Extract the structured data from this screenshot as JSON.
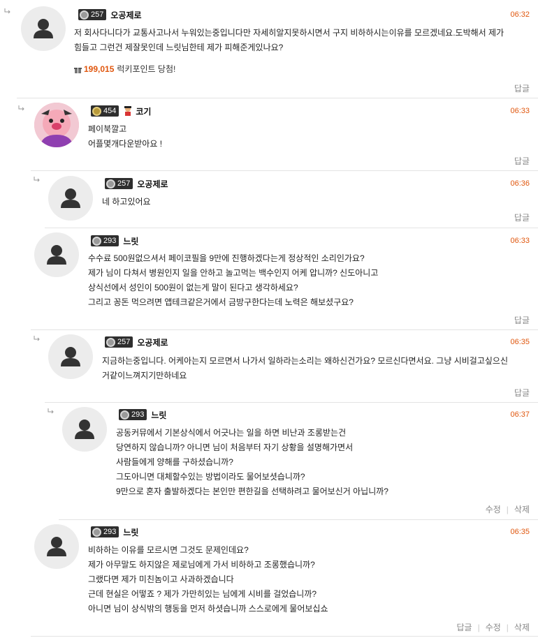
{
  "comments": [
    {
      "level": "257",
      "nickname": "오공제로",
      "time": "06:32",
      "lines": [
        "저 회사다니다가 교통사고나서 누워있는중입니다만 자세히알지못하시면서 구지 비하하시는이유를 모르겠네요.도박해서 제가",
        "힘들고 그런건 제잘못인데 느릿님한테 제가 피해준게있나요?"
      ],
      "lucky_points": "199,015",
      "lucky_label": "럭키포인트 당첨!",
      "reply_label": "답글"
    },
    {
      "level": "454",
      "nickname": "코기",
      "time": "06:33",
      "lines": [
        "페이북깔고",
        "어플몇개다운받아요 !"
      ],
      "reply_label": "답글"
    },
    {
      "level": "257",
      "nickname": "오공제로",
      "time": "06:36",
      "lines": [
        "네 하고있어요"
      ],
      "reply_label": "답글"
    },
    {
      "level": "293",
      "nickname": "느릿",
      "time": "06:33",
      "lines": [
        "수수료 500원없으셔서 페이코필을 9만에 진행하겠다는게 정상적인 소리인가요?",
        "제가 님이 다쳐서 병원인지 일을 안하고 놀고먹는 백수인지 어케 압니까? 신도아니고",
        "상식선에서 성인이 500원이 없는게 말이 된다고 생각하세요?",
        "그리고 꽁돈 먹으려면 앱테크같은거에서 금방구한다는데 노력은 해보셨구요?"
      ],
      "reply_label": "답글"
    },
    {
      "level": "257",
      "nickname": "오공제로",
      "time": "06:35",
      "lines": [
        "지금하는중입니다. 어케아는지 모르면서 나가서 일하라는소리는 왜하신건가요? 모르신다면서요. 그냥 시비걸고싶으신",
        "거같이느껴지기만하네요"
      ],
      "reply_label": "답글"
    },
    {
      "level": "293",
      "nickname": "느릿",
      "time": "06:37",
      "lines": [
        "공동커뮤에서 기본상식에서 어긋나는 일을 하면 비난과 조롱받는건",
        "당연하지 않습니까? 아니면 님이 처음부터 자기 상황을 설명해가면서",
        "사람들에게 양해를 구하셨습니까?",
        "그도아니면 대체할수있는 방법이라도 물어보셧습니까?",
        "9만으로 혼자 출발하겠다는 본인만 편한길을 선택하려고 물어보신거 아닙니까?"
      ],
      "edit_label": "수정",
      "delete_label": "삭제"
    },
    {
      "level": "293",
      "nickname": "느릿",
      "time": "06:35",
      "lines": [
        "비하하는 이유를 모르시면 그것도 문제인데요?",
        "제가 아무말도 하지않은 제로님에게 가서 비하하고 조롱했습니까?",
        "그랬다면 제가 미친놈이고 사과하겠습니다",
        "근데 현실은 어떻죠 ? 제가 가만히있는 님에게 시비를 걸었습니까?",
        "아니면 님이 상식밖의 행동을 먼저 하셧습니까 스스로에게 물어보십쇼"
      ],
      "reply_label": "답글",
      "edit_label": "수정",
      "delete_label": "삭제"
    }
  ]
}
